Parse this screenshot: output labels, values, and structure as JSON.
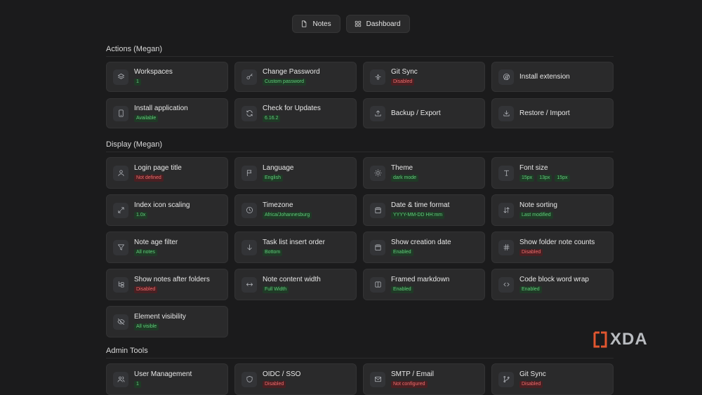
{
  "nav": {
    "notes": "Notes",
    "dashboard": "Dashboard"
  },
  "actions": {
    "title": "Actions (Megan)",
    "cards": [
      {
        "name": "workspaces",
        "title": "Workspaces",
        "icon": "layers-icon",
        "badges": [
          {
            "text": "1",
            "color": "green"
          }
        ]
      },
      {
        "name": "change-password",
        "title": "Change Password",
        "icon": "key-icon",
        "badges": [
          {
            "text": "Custom password",
            "color": "green"
          }
        ]
      },
      {
        "name": "git-sync",
        "title": "Git Sync",
        "icon": "git-icon",
        "badges": [
          {
            "text": "Disabled",
            "color": "red"
          }
        ]
      },
      {
        "name": "install-extension",
        "title": "Install extension",
        "icon": "chrome-icon",
        "badges": []
      },
      {
        "name": "install-application",
        "title": "Install application",
        "icon": "tablet-icon",
        "badges": [
          {
            "text": "Available",
            "color": "green"
          }
        ]
      },
      {
        "name": "check-updates",
        "title": "Check for Updates",
        "icon": "refresh-icon",
        "badges": [
          {
            "text": "6.16.2",
            "color": "green"
          }
        ]
      },
      {
        "name": "backup-export",
        "title": "Backup / Export",
        "icon": "upload-icon",
        "badges": []
      },
      {
        "name": "restore-import",
        "title": "Restore / Import",
        "icon": "download-icon",
        "badges": []
      }
    ]
  },
  "display": {
    "title": "Display (Megan)",
    "cards": [
      {
        "name": "login-page-title",
        "title": "Login page title",
        "icon": "user-icon",
        "badges": [
          {
            "text": "Not defined",
            "color": "red"
          }
        ]
      },
      {
        "name": "language",
        "title": "Language",
        "icon": "flag-icon",
        "badges": [
          {
            "text": "English",
            "color": "green"
          }
        ]
      },
      {
        "name": "theme",
        "title": "Theme",
        "icon": "sun-icon",
        "badges": [
          {
            "text": "dark mode",
            "color": "green"
          }
        ]
      },
      {
        "name": "font-size",
        "title": "Font size",
        "icon": "type-icon",
        "badges": [
          {
            "text": "15px",
            "color": "green"
          },
          {
            "text": "13px",
            "color": "green"
          },
          {
            "text": "15px",
            "color": "green"
          }
        ]
      },
      {
        "name": "index-icon-scaling",
        "title": "Index icon scaling",
        "icon": "expand-icon",
        "badges": [
          {
            "text": "1.0x",
            "color": "green"
          }
        ]
      },
      {
        "name": "timezone",
        "title": "Timezone",
        "icon": "clock-icon",
        "badges": [
          {
            "text": "Africa/Johannesburg",
            "color": "green"
          }
        ]
      },
      {
        "name": "date-time-format",
        "title": "Date & time format",
        "icon": "calendar-icon",
        "badges": [
          {
            "text": "YYYY-MM-DD HH:mm",
            "color": "green"
          }
        ]
      },
      {
        "name": "note-sorting",
        "title": "Note sorting",
        "icon": "sort-icon",
        "badges": [
          {
            "text": "Last modified",
            "color": "green"
          }
        ]
      },
      {
        "name": "note-age-filter",
        "title": "Note age filter",
        "icon": "filter-icon",
        "badges": [
          {
            "text": "All notes",
            "color": "green"
          }
        ]
      },
      {
        "name": "task-list-insert-order",
        "title": "Task list insert order",
        "icon": "arrow-down-icon",
        "badges": [
          {
            "text": "Bottom",
            "color": "green"
          }
        ]
      },
      {
        "name": "show-creation-date",
        "title": "Show creation date",
        "icon": "calendar-icon",
        "badges": [
          {
            "text": "Enabled",
            "color": "green"
          }
        ]
      },
      {
        "name": "show-folder-note-counts",
        "title": "Show folder note counts",
        "icon": "hash-icon",
        "badges": [
          {
            "text": "Disabled",
            "color": "red"
          }
        ]
      },
      {
        "name": "show-notes-after-folders",
        "title": "Show notes after folders",
        "icon": "folder-tree-icon",
        "badges": [
          {
            "text": "Disabled",
            "color": "red"
          }
        ]
      },
      {
        "name": "note-content-width",
        "title": "Note content width",
        "icon": "arrows-horizontal-icon",
        "badges": [
          {
            "text": "Full Width",
            "color": "green"
          }
        ]
      },
      {
        "name": "framed-markdown",
        "title": "Framed markdown",
        "icon": "columns-icon",
        "badges": [
          {
            "text": "Enabled",
            "color": "green"
          }
        ]
      },
      {
        "name": "code-block-word-wrap",
        "title": "Code block word wrap",
        "icon": "code-icon",
        "badges": [
          {
            "text": "Enabled",
            "color": "green"
          }
        ]
      },
      {
        "name": "element-visibility",
        "title": "Element visibility",
        "icon": "eye-off-icon",
        "badges": [
          {
            "text": "All visible",
            "color": "green"
          }
        ]
      }
    ]
  },
  "admin": {
    "title": "Admin Tools",
    "cards": [
      {
        "name": "user-management",
        "title": "User Management",
        "icon": "users-icon",
        "badges": [
          {
            "text": "1",
            "color": "green"
          }
        ]
      },
      {
        "name": "oidc-sso",
        "title": "OIDC / SSO",
        "icon": "shield-icon",
        "badges": [
          {
            "text": "Disabled",
            "color": "red"
          }
        ]
      },
      {
        "name": "smtp-email",
        "title": "SMTP / Email",
        "icon": "mail-icon",
        "badges": [
          {
            "text": "Not configured",
            "color": "red"
          }
        ]
      },
      {
        "name": "admin-git-sync",
        "title": "Git Sync",
        "icon": "git-branch-icon",
        "badges": [
          {
            "text": "Disabled",
            "color": "red"
          }
        ]
      }
    ]
  },
  "watermark": {
    "text": "XDA"
  }
}
